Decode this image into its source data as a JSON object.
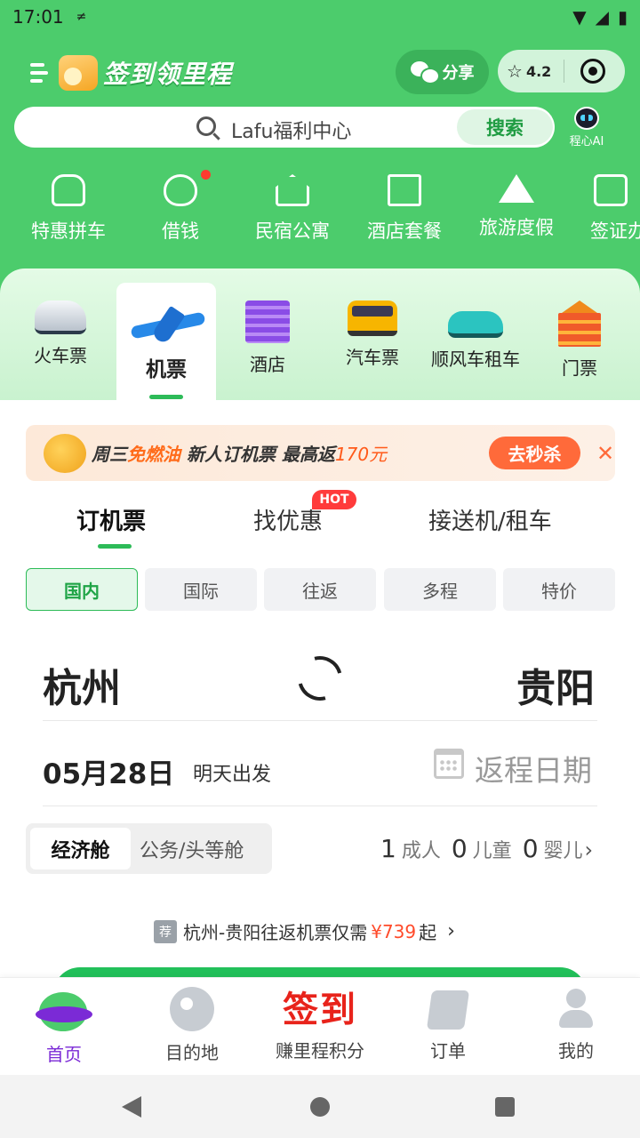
{
  "status_bar": {
    "time": "17:01"
  },
  "header": {
    "app_title": "签到领里程",
    "share_label": "分享",
    "rating": "4.2"
  },
  "search": {
    "placeholder": "Lafu福利中心",
    "button_label": "搜索",
    "ai_label": "程心AI"
  },
  "quick_links": [
    {
      "label": "特惠拼车",
      "icon": "carpool-icon"
    },
    {
      "label": "借钱",
      "icon": "money-bag-icon",
      "has_dot": true
    },
    {
      "label": "民宿公寓",
      "icon": "house-icon"
    },
    {
      "label": "酒店套餐",
      "icon": "hotel-building-icon"
    },
    {
      "label": "旅游度假",
      "icon": "mountain-icon"
    },
    {
      "label": "签证办",
      "icon": "passport-icon"
    }
  ],
  "categories": [
    {
      "label": "火车票",
      "icon": "train-icon"
    },
    {
      "label": "机票",
      "icon": "airplane-icon",
      "active": true
    },
    {
      "label": "酒店",
      "icon": "hotel-icon"
    },
    {
      "label": "汽车票",
      "icon": "bus-icon"
    },
    {
      "label": "顺风车租车",
      "icon": "car-icon"
    },
    {
      "label": "门票",
      "icon": "temple-icon"
    }
  ],
  "promo": {
    "day": "周三",
    "highlight": "免燃油",
    "text": "新人订机票 最高返",
    "amount": "170元",
    "button_label": "去秒杀",
    "close_label": "✕"
  },
  "flight_tabs": [
    {
      "label": "订机票",
      "active": true
    },
    {
      "label": "找优惠",
      "badge": "HOT"
    },
    {
      "label": "接送机/租车"
    }
  ],
  "trip_types": [
    "国内",
    "国际",
    "往返",
    "多程",
    "特价"
  ],
  "active_trip_type": "国内",
  "route": {
    "from": "杭州",
    "to": "贵阳"
  },
  "date": {
    "depart": "05月28日",
    "depart_note": "明天出发",
    "return_placeholder": "返程日期"
  },
  "cabin": {
    "selected": "经济舱",
    "other": "公务/头等舱"
  },
  "passengers": [
    {
      "count": "1",
      "label": "成人"
    },
    {
      "count": "0",
      "label": "儿童"
    },
    {
      "count": "0",
      "label": "婴儿"
    }
  ],
  "recommendation": {
    "badge": "荐",
    "text": "杭州-贵阳往返机票仅需",
    "price": "¥739",
    "suffix": "起"
  },
  "bottom_tabs": [
    {
      "label": "首页",
      "active": true
    },
    {
      "label": "目的地"
    },
    {
      "label": "赚里程积分",
      "icon_text": "签到"
    },
    {
      "label": "订单"
    },
    {
      "label": "我的"
    }
  ],
  "colors": {
    "brand_green": "#4ccc6c",
    "accent_green": "#2dbb58",
    "active_tab_purple": "#7b2ad6",
    "price_red": "#ff4a2a",
    "promo_orange": "#ff6a3a"
  }
}
